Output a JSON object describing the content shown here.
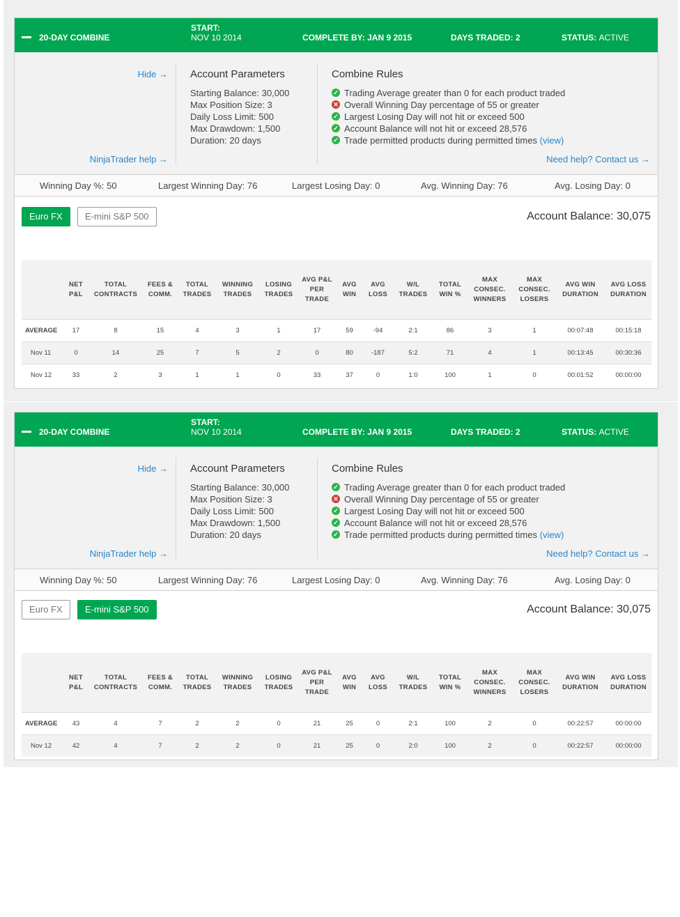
{
  "cards": [
    {
      "header": {
        "title": "20-DAY COMBINE",
        "start_label": "START:",
        "start_value": "NOV 10 2014",
        "complete_by": "COMPLETE BY: JAN 9 2015",
        "days_traded": "DAYS TRADED: 2",
        "status_label": "STATUS:",
        "status_value": "ACTIVE"
      },
      "hide_link": "Hide →",
      "ninjatrader_help": "NinjaTrader help →",
      "params": {
        "title": "Account Parameters",
        "items": [
          "Starting Balance: 30,000",
          "Max Position Size: 3",
          "Daily Loss Limit: 500",
          "Max Drawdown: 1,500",
          "Duration: 20 days"
        ]
      },
      "rules": {
        "title": "Combine Rules",
        "items": [
          "Trading Average greater than 0 for each product traded",
          "Overall Winning Day percentage of 55 or greater",
          "Largest Losing Day will not hit or exceed 500",
          "Account Balance will not hit or exceed 28,576",
          "Trade permitted products during permitted times"
        ],
        "view_link": "view",
        "help_link": "Need help? Contact us →"
      },
      "stats": [
        "Winning Day %: 50",
        "Largest Winning Day: 76",
        "Largest Losing Day: 0",
        "Avg. Winning Day: 76",
        "Avg. Losing Day: 0"
      ],
      "tabs": [
        "Euro FX",
        "E-mini S&P 500"
      ],
      "balance": "Account Balance: 30,075",
      "columns": [
        "",
        "NET P&L",
        "TOTAL CONTRACTS",
        "FEES & COMM.",
        "TOTAL TRADES",
        "WINNING TRADES",
        "LOSING TRADES",
        "AVG P&L PER TRADE",
        "AVG WIN",
        "AVG LOSS",
        "W/L TRADES",
        "TOTAL WIN %",
        "MAX CONSEC. WINNERS",
        "MAX CONSEC. LOSERS",
        "AVG WIN DURATION",
        "AVG LOSS DURATION"
      ],
      "rows": [
        [
          "AVERAGE",
          "17",
          "8",
          "15",
          "4",
          "3",
          "1",
          "17",
          "59",
          "-94",
          "2:1",
          "86",
          "3",
          "1",
          "00:07:48",
          "00:15:18"
        ],
        [
          "Nov 11",
          "0",
          "14",
          "25",
          "7",
          "5",
          "2",
          "0",
          "80",
          "-187",
          "5:2",
          "71",
          "4",
          "1",
          "00:13:45",
          "00:30:36"
        ],
        [
          "Nov 12",
          "33",
          "2",
          "3",
          "1",
          "1",
          "0",
          "33",
          "37",
          "0",
          "1:0",
          "100",
          "1",
          "0",
          "00:01:52",
          "00:00:00"
        ]
      ]
    },
    {
      "header": {
        "title": "20-DAY COMBINE",
        "start_label": "START:",
        "start_value": "NOV 10 2014",
        "complete_by": "COMPLETE BY: JAN 9 2015",
        "days_traded": "DAYS TRADED: 2",
        "status_label": "STATUS:",
        "status_value": "ACTIVE"
      },
      "hide_link": "Hide →",
      "ninjatrader_help": "NinjaTrader help →",
      "params": {
        "title": "Account Parameters",
        "items": [
          "Starting Balance: 30,000",
          "Max Position Size: 3",
          "Daily Loss Limit: 500",
          "Max Drawdown: 1,500",
          "Duration: 20 days"
        ]
      },
      "rules": {
        "title": "Combine Rules",
        "items": [
          "Trading Average greater than 0 for each product traded",
          "Overall Winning Day percentage of 55 or greater",
          "Largest Losing Day will not hit or exceed 500",
          "Account Balance will not hit or exceed 28,576",
          "Trade permitted products during permitted times"
        ],
        "view_link": "view",
        "help_link": "Need help? Contact us →"
      },
      "stats": [
        "Winning Day %: 50",
        "Largest Winning Day: 76",
        "Largest Losing Day: 0",
        "Avg. Winning Day: 76",
        "Avg. Losing Day: 0"
      ],
      "tabs": [
        "Euro FX",
        "E-mini S&P 500"
      ],
      "balance": "Account Balance: 30,075",
      "columns": [
        "",
        "NET P&L",
        "TOTAL CONTRACTS",
        "FEES & COMM.",
        "TOTAL TRADES",
        "WINNING TRADES",
        "LOSING TRADES",
        "AVG P&L PER TRADE",
        "AVG WIN",
        "AVG LOSS",
        "W/L TRADES",
        "TOTAL WIN %",
        "MAX CONSEC. WINNERS",
        "MAX CONSEC. LOSERS",
        "AVG WIN DURATION",
        "AVG LOSS DURATION"
      ],
      "rows": [
        [
          "AVERAGE",
          "43",
          "4",
          "7",
          "2",
          "2",
          "0",
          "21",
          "25",
          "0",
          "2:1",
          "100",
          "2",
          "0",
          "00:22:57",
          "00:00:00"
        ],
        [
          "Nov 12",
          "42",
          "4",
          "7",
          "2",
          "2",
          "0",
          "21",
          "25",
          "0",
          "2:0",
          "100",
          "2",
          "0",
          "00:22:57",
          "00:00:00"
        ]
      ]
    }
  ],
  "colors": {
    "brand": "#00a651",
    "link": "#2a85c8",
    "ok": "#2db34a",
    "fail": "#c8413d"
  },
  "rule_status": [
    "ok",
    "fail",
    "ok",
    "ok",
    "ok"
  ]
}
